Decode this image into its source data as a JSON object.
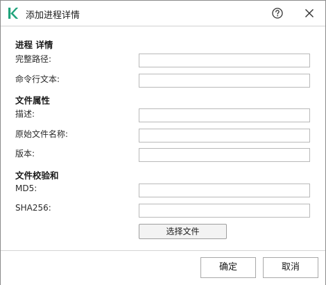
{
  "window": {
    "title": "添加进程详情",
    "logo_color": "#1fa37b",
    "help_icon": "help-circle-icon",
    "close_icon": "close-icon"
  },
  "sections": {
    "process_details": "进程 详情",
    "file_properties": "文件属性",
    "checksum": "文件校验和"
  },
  "fields": {
    "full_path": {
      "label": "完整路径:",
      "value": ""
    },
    "command_line": {
      "label": "命令行文本:",
      "value": ""
    },
    "description": {
      "label": "描述:",
      "value": ""
    },
    "original_name": {
      "label": "原始文件名称:",
      "value": ""
    },
    "version": {
      "label": "版本:",
      "value": ""
    },
    "md5": {
      "label": "MD5:",
      "value": ""
    },
    "sha256": {
      "label": "SHA256:",
      "value": ""
    }
  },
  "buttons": {
    "choose_file": "选择文件",
    "ok": "确定",
    "cancel": "取消"
  }
}
